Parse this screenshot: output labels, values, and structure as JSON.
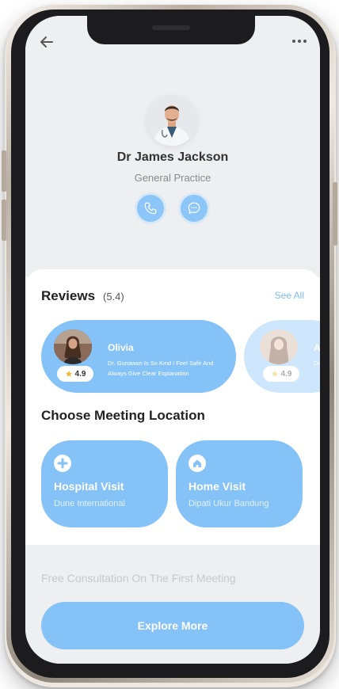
{
  "doctor": {
    "name": "Dr James Jackson",
    "specialty": "General Practice"
  },
  "icons": {
    "back": "back-arrow-icon",
    "more": "more-dots-icon",
    "call": "phone-icon",
    "chat": "chat-icon",
    "star": "star-icon",
    "hospital": "plus-icon",
    "home": "home-icon"
  },
  "reviews": {
    "title": "Reviews",
    "score": "(5.4)",
    "see_all": "See All",
    "items": [
      {
        "name": "Olivia",
        "rating": "4.9",
        "text": "Dr. Gunawan Is So Kind I Feel Safe And Always Give Clear Explanation"
      },
      {
        "name": "A",
        "rating": "4.9",
        "text": "Dr Ala"
      }
    ]
  },
  "meeting": {
    "title": "Choose Meeting Location",
    "options": [
      {
        "title": "Hospital Visit",
        "subtitle": "Dune International"
      },
      {
        "title": "Home Visit",
        "subtitle": "Dipati Ukur Bandung"
      }
    ]
  },
  "footer": {
    "note": "Free Consultation On The First Meeting",
    "cta": "Explore More"
  },
  "colors": {
    "accent": "#85c2f7",
    "top_bg": "#eeeff1",
    "star": "#f5b82e"
  }
}
